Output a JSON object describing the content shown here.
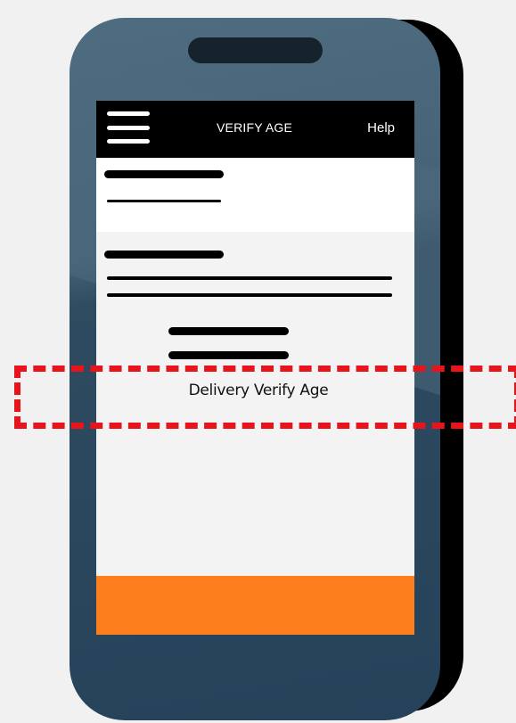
{
  "header": {
    "title": "VERIFY AGE",
    "help_label": "Help"
  },
  "content": {
    "highlighted_label": "Delivery Verify Age"
  },
  "icons": {
    "menu": "hamburger-menu-icon"
  },
  "colors": {
    "header_bg": "#000000",
    "footer_bar": "#fc7e1c",
    "highlight_dash": "#e8141b",
    "phone_body": "#2f4b60"
  }
}
